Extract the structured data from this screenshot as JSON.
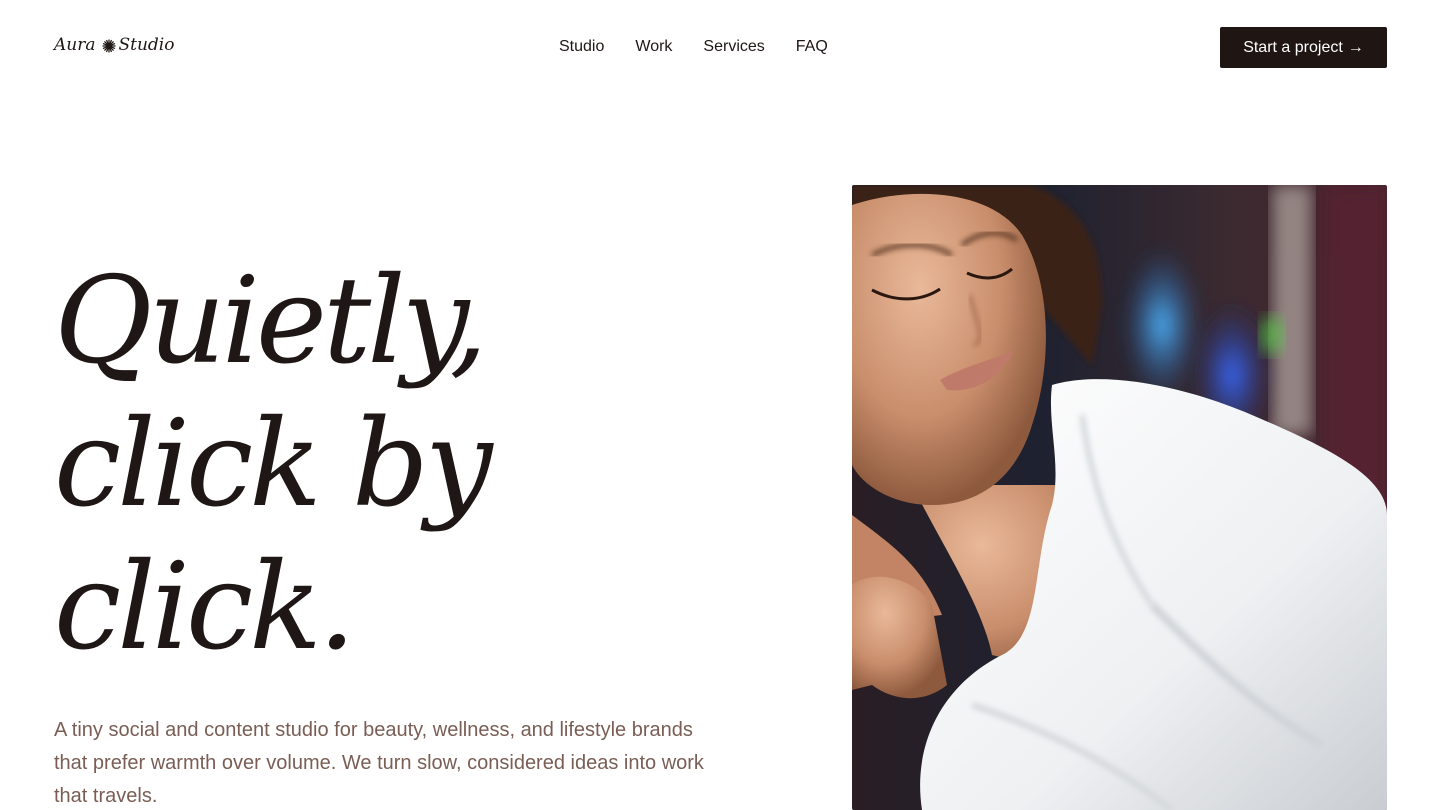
{
  "brand": {
    "name_part1": "Aura",
    "name_part2": "Studio",
    "mark_icon": "sunburst-icon"
  },
  "nav": {
    "items": [
      "Studio",
      "Work",
      "Services",
      "FAQ"
    ]
  },
  "cta": {
    "label": "Start a project",
    "arrow": "→"
  },
  "hero": {
    "headline_lines": [
      "Quietly,",
      "click by",
      "click."
    ],
    "intro": "A tiny social and content studio for beauty, wellness, and lifestyle brands that prefer warmth over volume. We turn slow, considered ideas into work that travels.",
    "image_alt": "woman-in-white-robe-photo"
  },
  "colors": {
    "ink": "#1e1715",
    "button_bg": "#1f1512",
    "body_text": "#7a5e55",
    "background": "#ffffff"
  }
}
